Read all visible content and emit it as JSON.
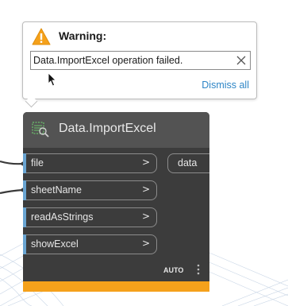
{
  "warning": {
    "title": "Warning:",
    "message": "Data.ImportExcel operation failed.",
    "dismiss_label": "Dismiss all",
    "icon": "warning-triangle-icon",
    "accent_color": "#f5a11b"
  },
  "node": {
    "title": "Data.ImportExcel",
    "icon": "import-excel-icon",
    "inputs": [
      {
        "label": "file",
        "chevron": ">"
      },
      {
        "label": "sheetName",
        "chevron": ">"
      },
      {
        "label": "readAsStrings",
        "chevron": ">"
      },
      {
        "label": "showExcel",
        "chevron": ">"
      }
    ],
    "output": {
      "label": "data"
    },
    "lacing": "AUTO",
    "status_color": "#f5a11b",
    "port_color": "#6aa5d2"
  },
  "colors": {
    "node_body": "#3c3c3c",
    "node_header": "#535353",
    "link": "#2d85c6"
  }
}
